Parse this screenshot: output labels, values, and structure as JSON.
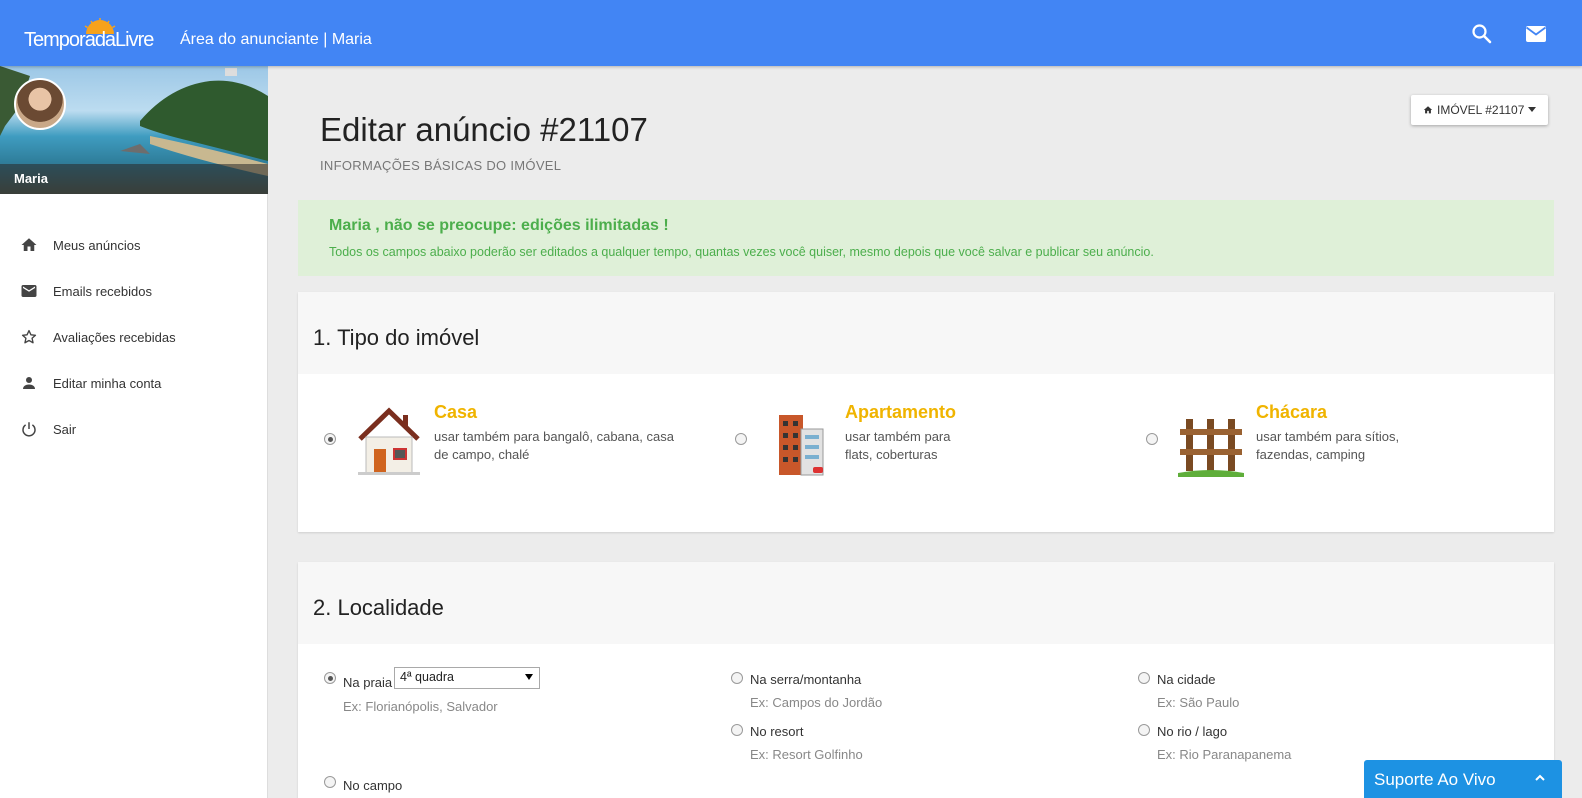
{
  "header": {
    "logo_text": "TemporadaLivre",
    "title": "Área do anunciante | Maria",
    "icons": [
      "search-icon",
      "mail-icon"
    ],
    "color": "#4285f4"
  },
  "sidebar": {
    "user_name": "Maria",
    "items": [
      {
        "label": "Meus anúncios",
        "icon": "home-icon"
      },
      {
        "label": "Emails recebidos",
        "icon": "mail-icon"
      },
      {
        "label": "Avaliações recebidas",
        "icon": "star-icon"
      },
      {
        "label": "Editar minha conta",
        "icon": "person-icon"
      },
      {
        "label": "Sair",
        "icon": "power-icon"
      }
    ]
  },
  "main": {
    "title": "Editar anúncio #21107",
    "subtitle": "INFORMAÇÕES BÁSICAS DO IMÓVEL",
    "property_button": "IMÓVEL #21107",
    "notice": {
      "title": "Maria , não se preocupe: edições ilimitadas !",
      "text": "Todos os campos abaixo poderão ser editados a qualquer tempo, quantas vezes você quiser, mesmo depois que você salvar e publicar seu anúncio.",
      "color": "#4cae4c"
    },
    "section1": {
      "title": "1. Tipo do imóvel",
      "options": [
        {
          "name": "Casa",
          "desc": "usar também para bangalô, cabana, casa de campo, chalé",
          "selected": true
        },
        {
          "name": "Apartamento",
          "desc": "usar também para flats, coberturas",
          "selected": false
        },
        {
          "name": "Chácara",
          "desc": "usar também para sítios, fazendas, camping",
          "selected": false
        }
      ]
    },
    "section2": {
      "title": "2. Localidade",
      "options": [
        {
          "label": "Na praia",
          "example": "Ex: Florianópolis, Salvador",
          "selected": true,
          "select_value": "4ª quadra"
        },
        {
          "label": "Na serra/montanha",
          "example": "Ex: Campos do Jordão",
          "selected": false
        },
        {
          "label": "Na cidade",
          "example": "Ex: São Paulo",
          "selected": false
        },
        {
          "label": "No resort",
          "example": "Ex: Resort Golfinho",
          "selected": false
        },
        {
          "label": "No rio / lago",
          "example": "Ex: Rio Paranapanema",
          "selected": false
        },
        {
          "label": "No campo",
          "example": "",
          "selected": false
        }
      ]
    }
  },
  "support": {
    "label": "Suporte Ao Vivo",
    "color": "#1d92e3"
  }
}
